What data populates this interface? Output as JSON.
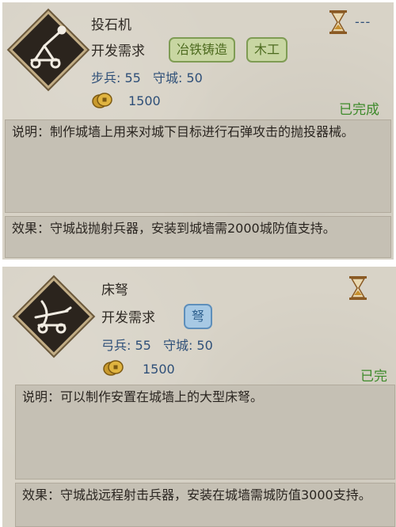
{
  "cards": [
    {
      "name": "投石机",
      "requirement_label": "开发需求",
      "tags": [
        {
          "label": "冶铁铸造",
          "style": "green"
        },
        {
          "label": "木工",
          "style": "green"
        }
      ],
      "stats": [
        {
          "label": "步兵",
          "value": "55"
        },
        {
          "label": "守城",
          "value": "50"
        }
      ],
      "stat_texts": [
        "步兵: 55",
        "守城: 50"
      ],
      "cost": "1500",
      "status": "已完成",
      "cooldown": "---",
      "description": "说明：制作城墙上用来对城下目标进行石弹攻击的抛投器械。",
      "effect": "效果：守城战抛射兵器，安装到城墙需2000城防值支持。"
    },
    {
      "name": "床弩",
      "requirement_label": "开发需求",
      "tags": [
        {
          "label": "弩",
          "style": "blue"
        }
      ],
      "stat_texts": [
        "弓兵: 55",
        "守城: 50"
      ],
      "cost": "1500",
      "status": "已完",
      "description": "说明：可以制作安置在城墙上的大型床弩。",
      "effect": "效果：守城战远程射击兵器，安装在城墙需城防值3000支持。"
    }
  ],
  "colors": {
    "card_bg": "#d8d3c7",
    "panel_bg": "#c5c0b4",
    "stat_text": "#2e4f78",
    "status_green": "#3d8a2a",
    "tag_green": "#c8d6a2",
    "tag_blue": "#a7c9e4"
  },
  "icons": {
    "catapult": "catapult-icon",
    "ballista": "ballista-icon",
    "coin": "coin-icon",
    "hourglass": "hourglass-icon"
  }
}
